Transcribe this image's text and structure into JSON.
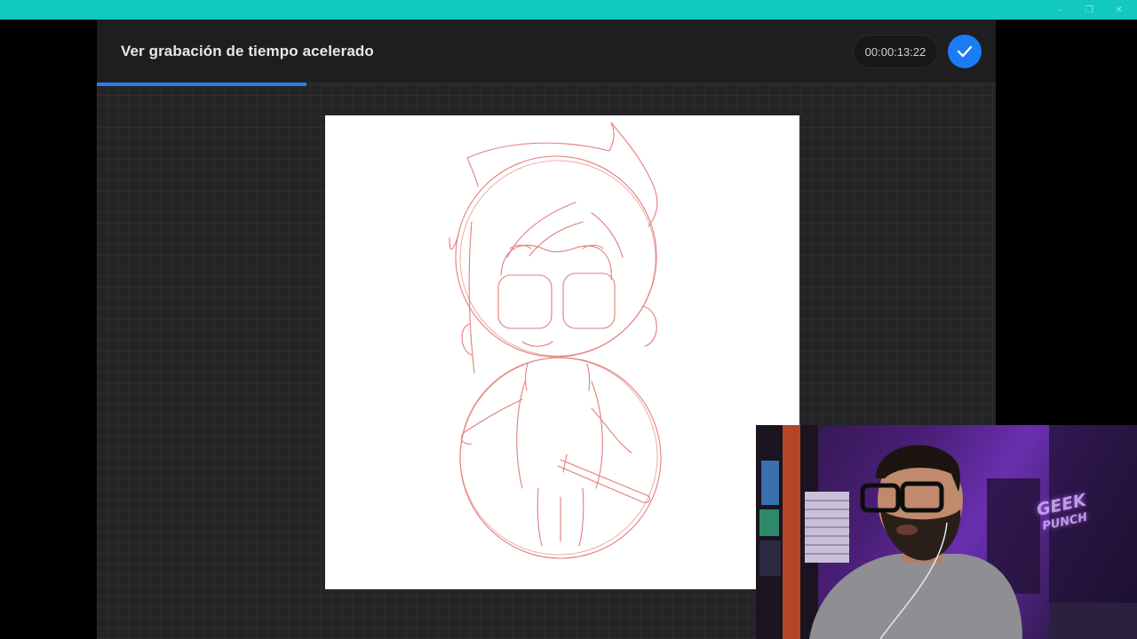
{
  "window": {
    "controls": [
      "–",
      "❐",
      "✕"
    ],
    "accent_color": "#12c9c0"
  },
  "header": {
    "title": "Ver grabación de tiempo acelerado",
    "timer": "00:00:13:22",
    "done_icon": "checkmark-icon",
    "done_color": "#1a7cf5"
  },
  "playback": {
    "progress": 0.233
  },
  "webcam": {
    "sign_text_line1": "GEEK",
    "sign_text_line2": "PUNCH"
  }
}
